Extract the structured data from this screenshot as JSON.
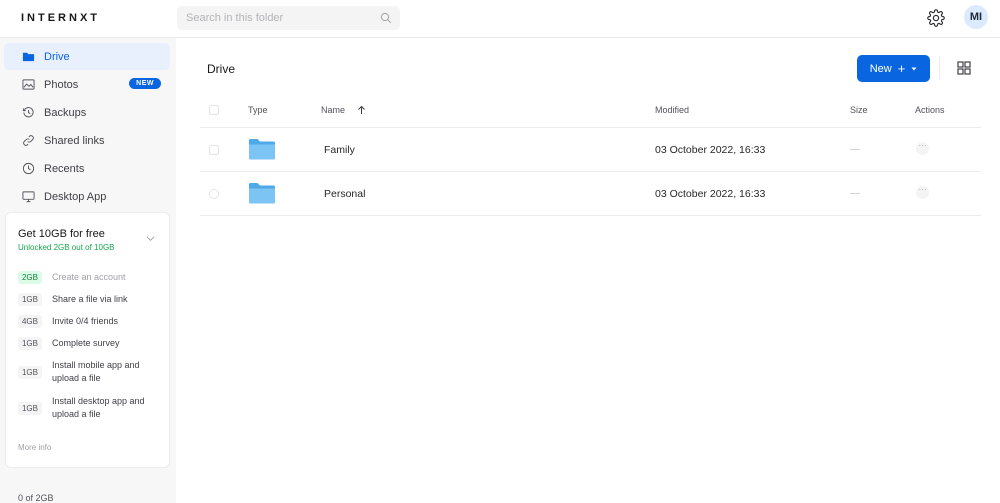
{
  "app": {
    "logo_text": "INTERNXT"
  },
  "header": {
    "search_placeholder": "Search in this folder",
    "avatar_initials": "MI"
  },
  "sidebar": {
    "items": [
      {
        "label": "Drive",
        "icon": "folder-icon",
        "active": true
      },
      {
        "label": "Photos",
        "icon": "photos-icon",
        "badge": "NEW"
      },
      {
        "label": "Backups",
        "icon": "history-icon"
      },
      {
        "label": "Shared links",
        "icon": "link-icon"
      },
      {
        "label": "Recents",
        "icon": "clock-icon"
      },
      {
        "label": "Desktop App",
        "icon": "desktop-icon"
      }
    ],
    "promo": {
      "title": "Get 10GB for free",
      "subtitle": "Unlocked 2GB out of 10GB",
      "tasks": [
        {
          "size": "2GB",
          "label": "Create an account",
          "done": true
        },
        {
          "size": "1GB",
          "label": "Share a file via link",
          "done": false
        },
        {
          "size": "4GB",
          "label": "Invite 0/4 friends",
          "done": false
        },
        {
          "size": "1GB",
          "label": "Complete survey",
          "done": false
        },
        {
          "size": "1GB",
          "label": "Install mobile app and upload a file",
          "done": false
        },
        {
          "size": "1GB",
          "label": "Install desktop app and upload a file",
          "done": false
        }
      ],
      "more_info": "More info"
    },
    "usage": "0 of 2GB"
  },
  "main": {
    "breadcrumb": "Drive",
    "new_button": "New",
    "columns": {
      "type": "Type",
      "name": "Name",
      "modified": "Modified",
      "size": "Size",
      "actions": "Actions"
    },
    "rows": [
      {
        "name": "Family",
        "modified": "03 October 2022, 16:33",
        "size": "—"
      },
      {
        "name": "Personal",
        "modified": "03 October 2022, 16:33",
        "size": "—"
      }
    ]
  },
  "colors": {
    "accent": "#0a66e0",
    "folder": "#60b8f0",
    "success": "#16a34a"
  }
}
